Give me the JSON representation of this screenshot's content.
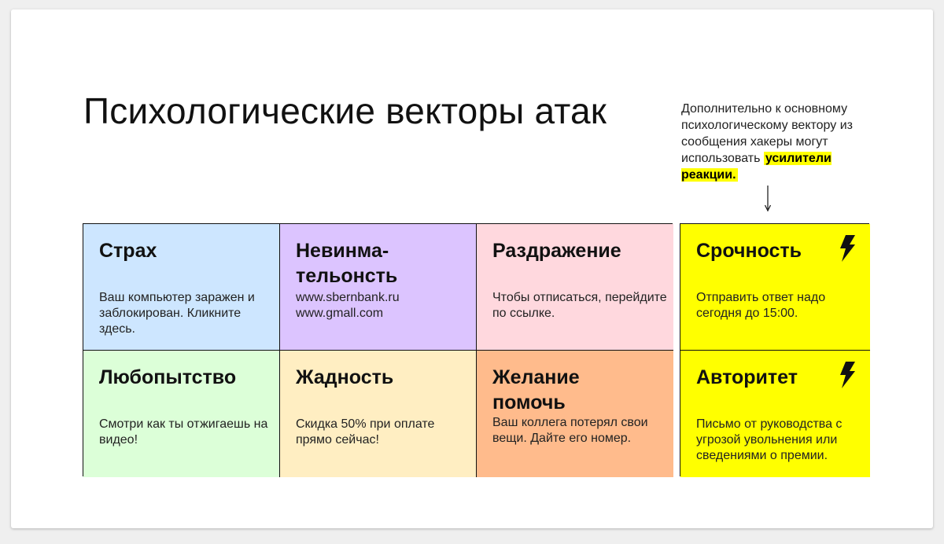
{
  "title": "Психологические векторы атак",
  "note": {
    "text": "Дополнительно к основному психологическому вектору из сообщения хакеры могут использовать",
    "highlight": "усилители реакции."
  },
  "cells": [
    {
      "title": "Страх",
      "text": "Ваш компьютер заражен и заблокирован. Кликните здесь.",
      "color": "#cde6ff"
    },
    {
      "title": "Невинма-тельонсть",
      "text": "www.sbernbank.ru www.gmall.com",
      "color": "#dcc4ff"
    },
    {
      "title": "Раздражение",
      "text": "Чтобы отписаться, перейдите по ссылке.",
      "color": "#ffd8de"
    },
    {
      "title": "Любопытство",
      "text": "Смотри как ты отжигаешь на видео!",
      "color": "#dcffd8"
    },
    {
      "title": "Жадность",
      "text": "Скидка 50% при оплате прямо сейчас!",
      "color": "#ffeec2"
    },
    {
      "title": "Желание помочь",
      "text": "Ваш коллега потерял свои вещи. Дайте его номер.",
      "color": "#ffbb8c"
    }
  ],
  "amplifiers": [
    {
      "title": "Срочность",
      "text": "Отправить ответ надо сегодня до 15:00.",
      "icon": "lightning-icon",
      "color": "#ffff00"
    },
    {
      "title": "Авторитет",
      "text": "Письмо от руководства с угрозой увольнения или сведениями о премии.",
      "icon": "lightning-icon",
      "color": "#ffff00"
    }
  ]
}
